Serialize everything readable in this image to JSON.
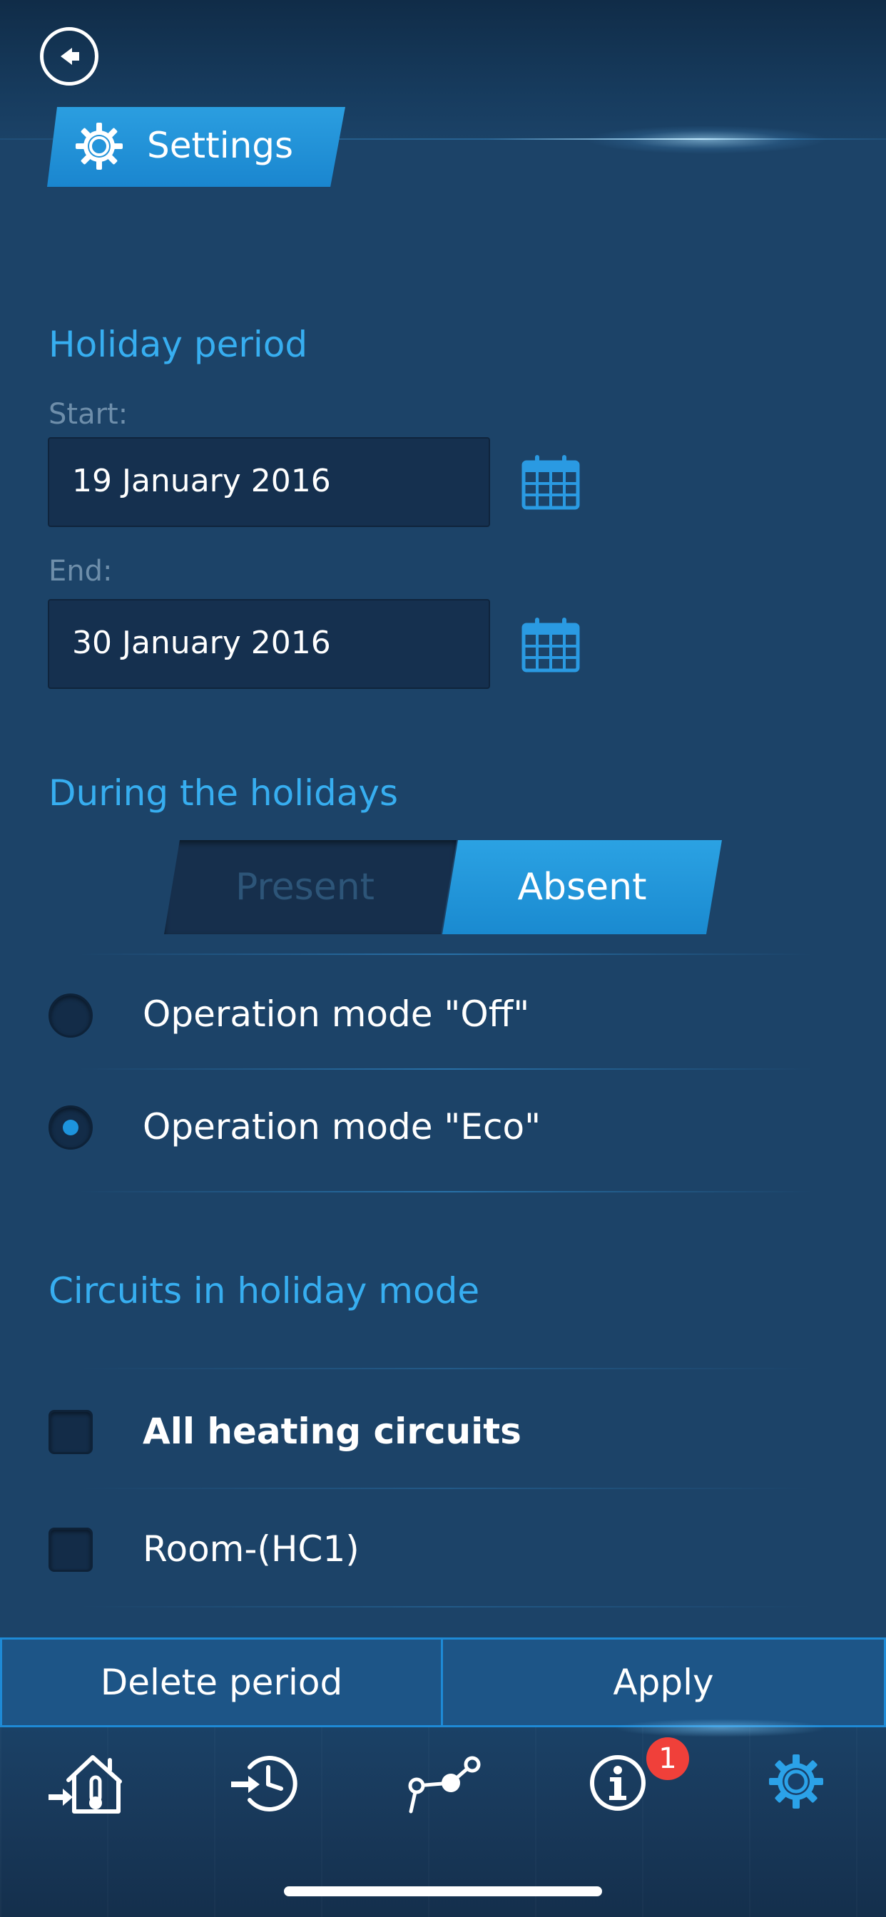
{
  "header": {
    "title": "Settings"
  },
  "holiday_period": {
    "title": "Holiday period",
    "start_label": "Start:",
    "start_value": "19 January 2016",
    "end_label": "End:",
    "end_value": "30 January 2016"
  },
  "during_holidays": {
    "title": "During the holidays",
    "segment_present": "Present",
    "segment_absent": "Absent",
    "selected_segment": "Absent",
    "options": [
      {
        "label": "Operation mode \"Off\"",
        "selected": false
      },
      {
        "label": "Operation mode \"Eco\"",
        "selected": true
      }
    ]
  },
  "circuits": {
    "title": "Circuits in holiday mode",
    "items": [
      {
        "label": "All heating circuits",
        "checked": false
      },
      {
        "label": "Room-(HC1)",
        "checked": false
      }
    ]
  },
  "actions": {
    "delete_label": "Delete period",
    "apply_label": "Apply"
  },
  "tabbar": {
    "tabs": [
      {
        "icon": "home-thermometer-icon",
        "active": false
      },
      {
        "icon": "clock-schedule-icon",
        "active": false
      },
      {
        "icon": "graph-nodes-icon",
        "active": false
      },
      {
        "icon": "info-icon",
        "active": false
      },
      {
        "icon": "gear-icon",
        "active": true
      }
    ],
    "info_badge": "1"
  },
  "colors": {
    "background": "#1c4368",
    "accent": "#37aef0",
    "segment_active": "#1a8ad0",
    "badge": "#f0403a"
  }
}
